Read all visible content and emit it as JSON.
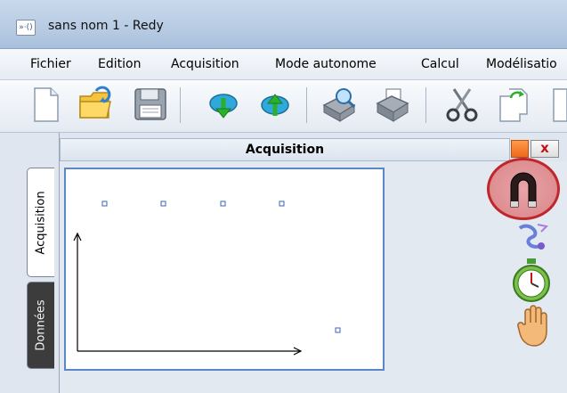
{
  "window": {
    "title": "sans nom 1 - Redy",
    "app_icon_text": "»·()"
  },
  "menu": {
    "items": [
      {
        "label": "Fichier"
      },
      {
        "label": "Edition"
      },
      {
        "label": "Acquisition"
      },
      {
        "label": "Mode autonome"
      },
      {
        "label": "Calcul"
      },
      {
        "label": "Modélisatio"
      }
    ]
  },
  "toolbar": {
    "buttons": [
      {
        "icon": "new-document-icon"
      },
      {
        "icon": "open-folder-icon"
      },
      {
        "icon": "save-floppy-icon"
      },
      {
        "icon": "cloud-download-icon"
      },
      {
        "icon": "cloud-upload-icon"
      },
      {
        "icon": "print-preview-icon"
      },
      {
        "icon": "printer-icon"
      },
      {
        "icon": "scissors-icon"
      },
      {
        "icon": "copy-icon"
      }
    ]
  },
  "side_tabs": [
    {
      "label": "Acquisition",
      "active": true
    },
    {
      "label": "Données",
      "active": false
    }
  ],
  "panel": {
    "title": "Acquisition",
    "close_label": "x",
    "accent_color": "#5b87c6"
  },
  "right_tools": [
    {
      "icon": "magnet-icon",
      "highlight_color": "#c0262c"
    },
    {
      "icon": "snake-probe-icon"
    },
    {
      "icon": "stopwatch-icon"
    },
    {
      "icon": "hand-icon"
    }
  ]
}
